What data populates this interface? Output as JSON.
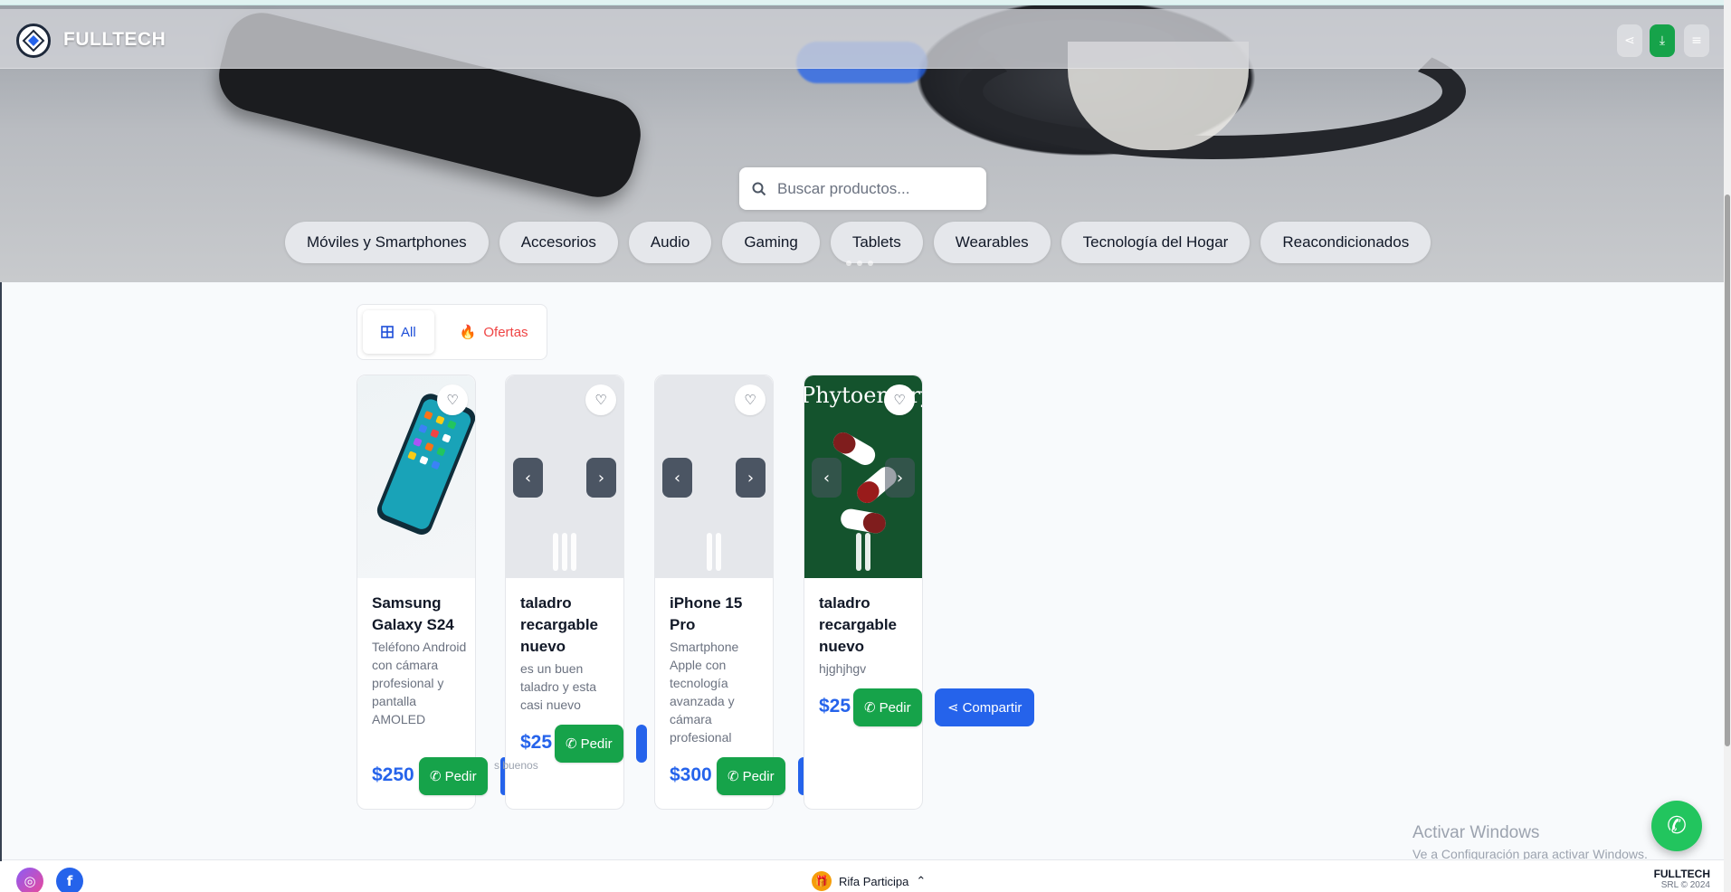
{
  "app": {
    "brand": "FULLTECH"
  },
  "search": {
    "placeholder": "Buscar productos..."
  },
  "categories": [
    "Móviles y Smartphones",
    "Accesorios",
    "Audio",
    "Gaming",
    "Tablets",
    "Wearables",
    "Tecnología del Hogar",
    "Reacondicionados"
  ],
  "filters": {
    "all": "All",
    "offers": "Ofertas"
  },
  "products": [
    {
      "title": "Samsung Galaxy S24",
      "desc": "Teléfono Android con cámara profesional y pantalla AMOLED",
      "price": "$250",
      "order": "Pedir"
    },
    {
      "title": "taladro recargable nuevo",
      "desc": "es un buen taladro y esta casi nuevo",
      "price": "$25",
      "order": "Pedir"
    },
    {
      "title": "iPhone 15 Pro",
      "desc": "Smartphone Apple con tecnología avanzada y cámara profesional",
      "price": "$300",
      "order": "Pedir"
    },
    {
      "title": "taladro recargable nuevo",
      "desc": "hjghjhgv",
      "price": "$25",
      "order": "Pedir",
      "share": "Compartir"
    }
  ],
  "card4_image_text": "Phytoemory",
  "card2_note": "s buenos",
  "windows": {
    "line1": "Activar Windows",
    "line2": "Ve a Configuración para activar Windows."
  },
  "footer": {
    "rifa": "Rifa Participa",
    "brand": "FULLTECH",
    "copy": "SRL © 2024"
  },
  "colors": {
    "primary": "#2563eb",
    "whatsapp": "#16a34a",
    "offer": "#ef4444"
  }
}
